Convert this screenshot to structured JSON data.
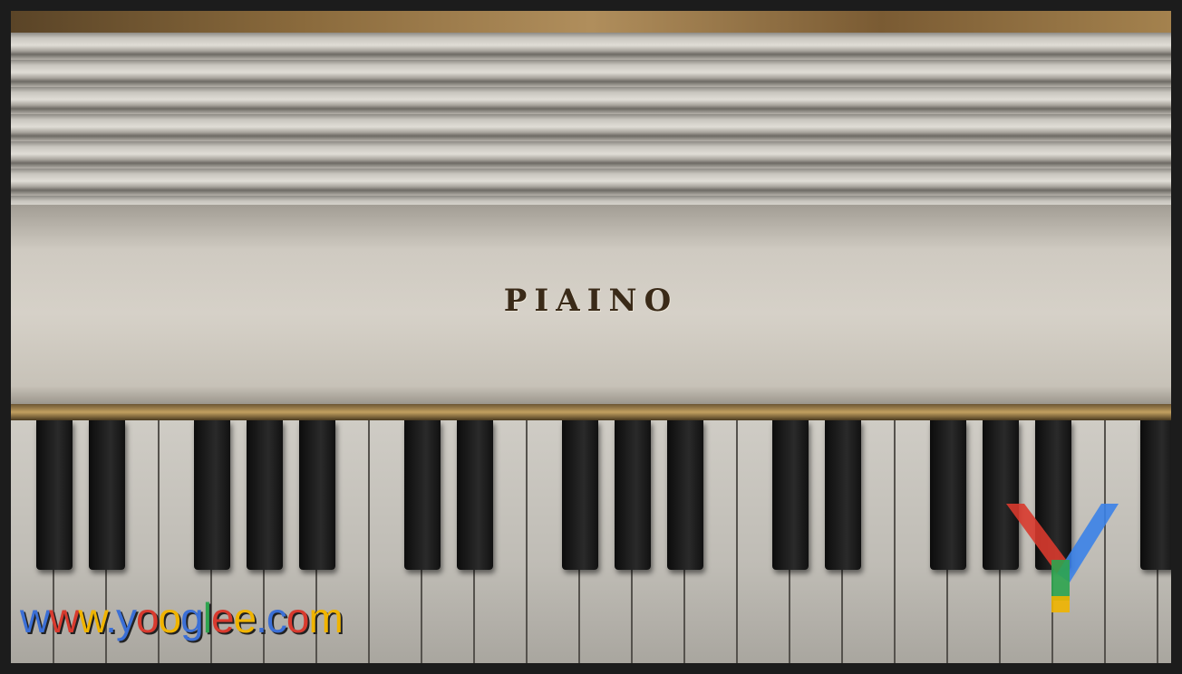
{
  "photo": {
    "subject": "piano-keyboard",
    "brand_text": "PIAINO"
  },
  "watermark": {
    "text": "www.yooglee.com",
    "letter_colors": [
      "#3b6fd6",
      "#d83a2e",
      "#f0b400",
      "#3b6fd6",
      "#3b6fd6",
      "#d83a2e",
      "#f0b400",
      "#3b6fd6",
      "#2ea44f",
      "#d83a2e",
      "#f0b400",
      "#3b6fd6",
      "#3b6fd6",
      "#d83a2e",
      "#f0b400"
    ],
    "logo_letter": "Y"
  }
}
